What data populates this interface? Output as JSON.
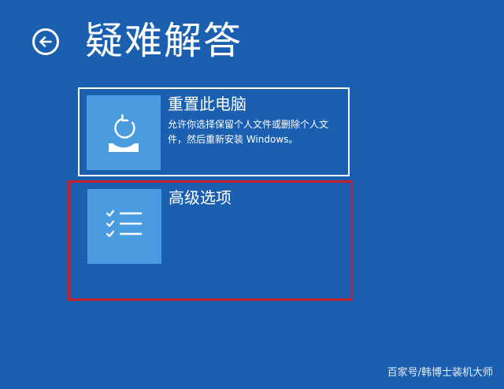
{
  "page": {
    "title": "疑难解答",
    "back_icon": "back-arrow-icon"
  },
  "options": [
    {
      "title": "重置此电脑",
      "description": "允许你选择保留个人文件或删除个人文件，然后重新安装 Windows。",
      "icon": "reset-pc-icon",
      "highlighted": false
    },
    {
      "title": "高级选项",
      "icon": "checklist-icon",
      "highlighted": true,
      "highlight_color": "#c8202c"
    }
  ],
  "watermark": "百家号/韩博士装机大师",
  "colors": {
    "background": "#1b5fb1",
    "tile_icon_bg": "#4b9be0"
  }
}
